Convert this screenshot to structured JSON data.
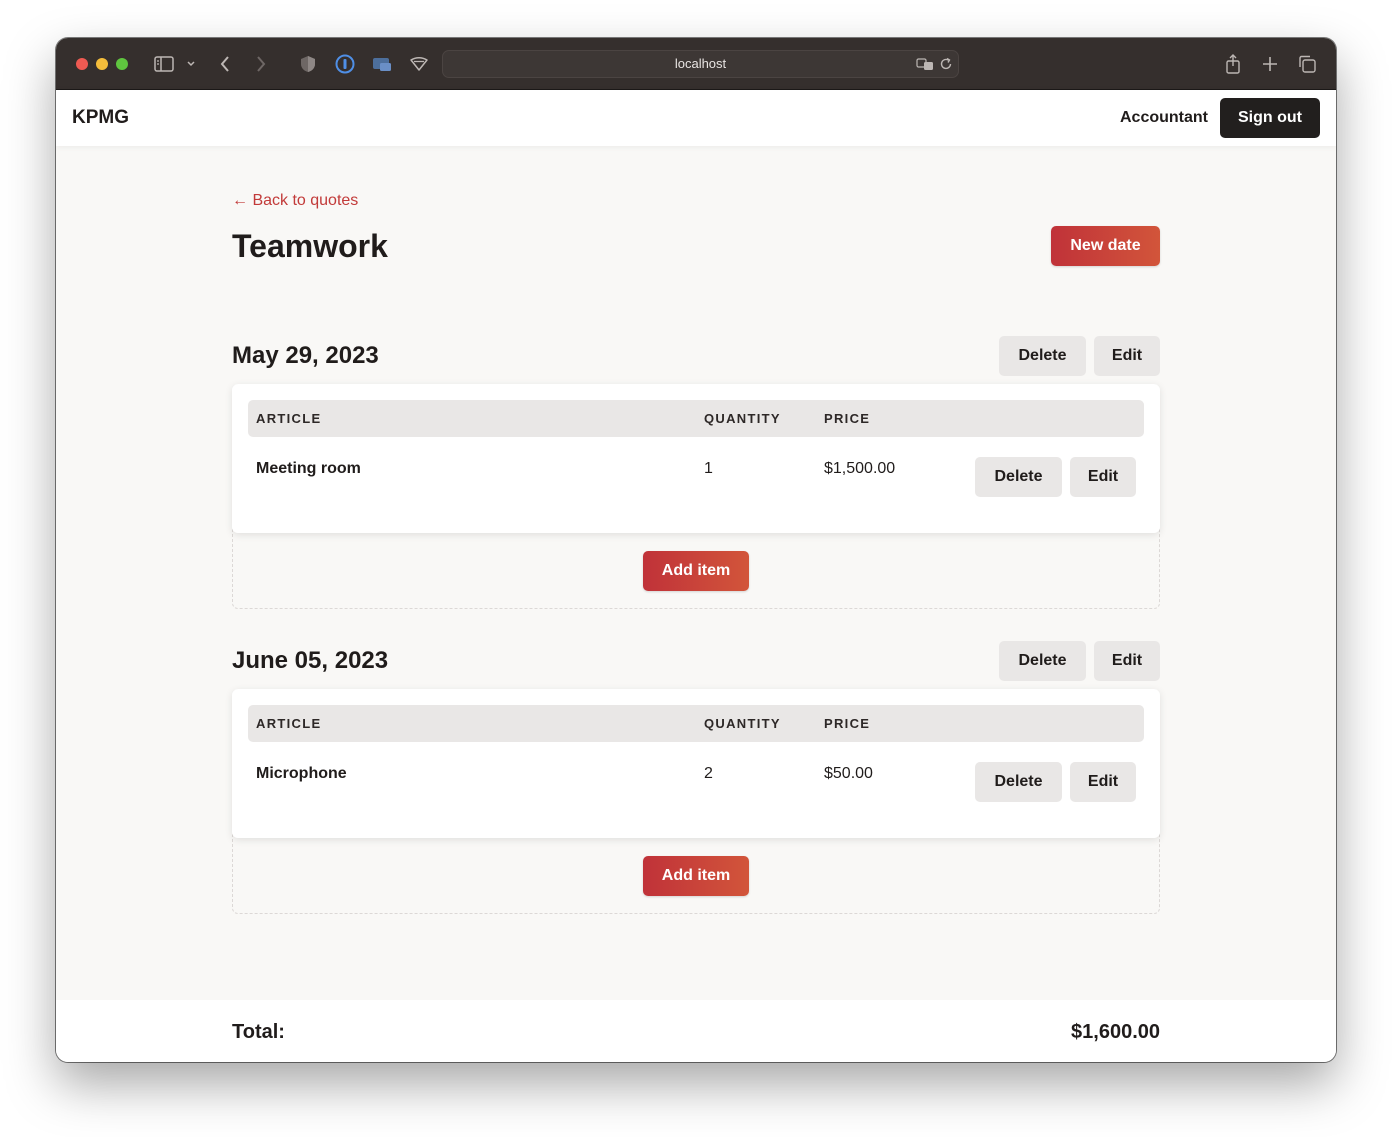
{
  "browser": {
    "url": "localhost"
  },
  "header": {
    "brand": "KPMG",
    "user_role": "Accountant",
    "sign_out_label": "Sign out"
  },
  "page": {
    "back_link": "← Back to quotes",
    "title": "Teamwork",
    "new_date_label": "New date"
  },
  "table_headers": {
    "article": "ARTICLE",
    "quantity": "QUANTITY",
    "price": "PRICE"
  },
  "actions": {
    "delete": "Delete",
    "edit": "Edit",
    "add_item": "Add item"
  },
  "dates": [
    {
      "date": "May 29, 2023",
      "items": [
        {
          "article": "Meeting room",
          "quantity": "1",
          "price": "$1,500.00"
        }
      ]
    },
    {
      "date": "June 05, 2023",
      "items": [
        {
          "article": "Microphone",
          "quantity": "2",
          "price": "$50.00"
        }
      ]
    }
  ],
  "footer": {
    "total_label": "Total:",
    "total_value": "$1,600.00"
  },
  "colors": {
    "accent_start": "#c03239",
    "accent_end": "#d2553a",
    "link": "#c23a39",
    "dark_button": "#221f1e",
    "light_button": "#e9e7e6",
    "page_bg": "#f9f8f6"
  }
}
